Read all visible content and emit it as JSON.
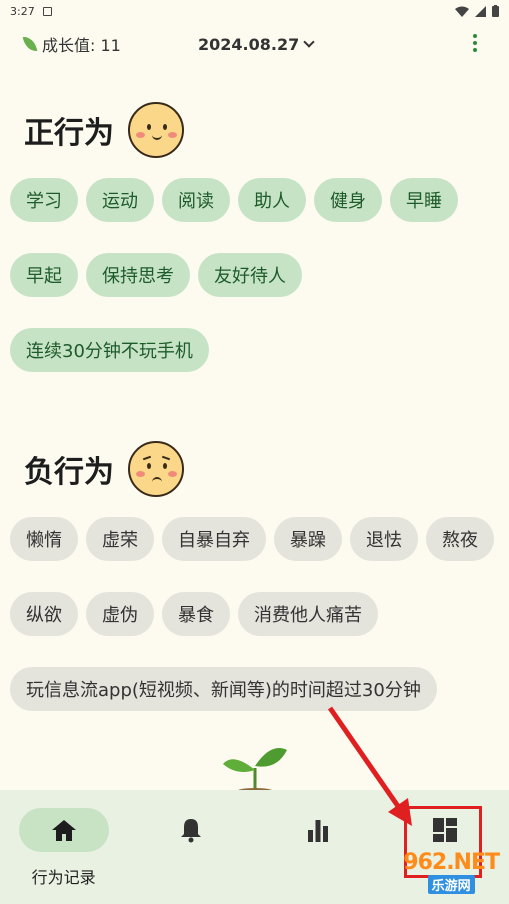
{
  "status": {
    "time": "3:27"
  },
  "header": {
    "growth_label": "成长值: 11",
    "date": "2024.08.27"
  },
  "positive": {
    "title": "正行为",
    "items": [
      "学习",
      "运动",
      "阅读",
      "助人",
      "健身",
      "早睡",
      "早起",
      "保持思考",
      "友好待人",
      "连续30分钟不玩手机"
    ]
  },
  "negative": {
    "title": "负行为",
    "items": [
      "懒惰",
      "虚荣",
      "自暴自弃",
      "暴躁",
      "退怯",
      "熬夜",
      "纵欲",
      "虚伪",
      "暴食",
      "消费他人痛苦",
      "玩信息流app(短视频、新闻等)的时间超过30分钟"
    ]
  },
  "nav": {
    "items": [
      {
        "label": "行为记录",
        "icon": "home-icon"
      },
      {
        "label": "",
        "icon": "bell-icon"
      },
      {
        "label": "",
        "icon": "bar-chart-icon"
      },
      {
        "label": "",
        "icon": "dashboard-icon"
      }
    ]
  },
  "watermark": {
    "top": "962.NET",
    "bottom": "乐游网"
  },
  "colors": {
    "accent": "#2e8b3a",
    "chip_pos": "#c6e3c6",
    "chip_neg": "#e4e3dc",
    "nav_bg": "#e9f1e3",
    "annotation": "#e02020"
  }
}
